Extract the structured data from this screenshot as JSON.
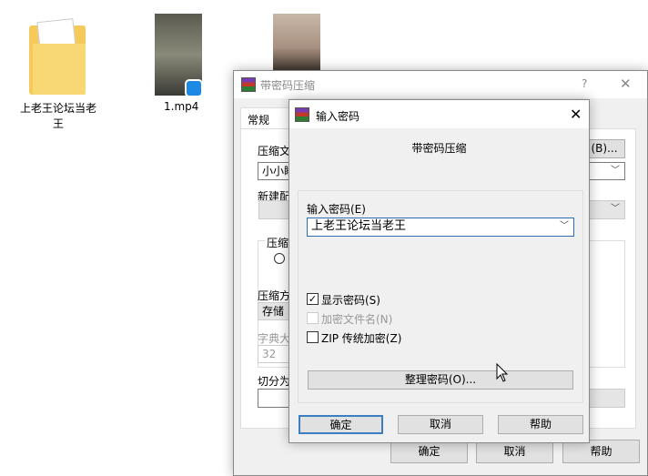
{
  "desktop": {
    "items": [
      {
        "label_line1": "上老王论坛当老",
        "label_line2": "王"
      },
      {
        "label": "1.mp4"
      },
      {
        "label": ""
      }
    ]
  },
  "back_dialog": {
    "title": "带密码压缩",
    "help": "?",
    "close": "✕",
    "tab": "常规",
    "archive_name_label": "压缩文",
    "archive_name_value": "小小睡",
    "browse": "(B)...",
    "profile_label": "新建配",
    "format_group": "压缩",
    "method_label": "压缩方",
    "method_value": "存储",
    "dict_label": "字典大",
    "dict_value": "32",
    "split_label": "切分为",
    "ok": "确定",
    "cancel": "取消",
    "help_btn": "帮助"
  },
  "front_dialog": {
    "title": "输入密码",
    "close": "✕",
    "subtitle": "带密码压缩",
    "password_label": "输入密码(E)",
    "password_value": "上老王论坛当老王",
    "show_password": "显示密码(S)",
    "show_password_checked": true,
    "encrypt_names": "加密文件名(N)",
    "encrypt_names_checked": false,
    "zip_legacy": "ZIP 传统加密(Z)",
    "zip_legacy_checked": false,
    "organize": "整理密码(O)...",
    "ok": "确定",
    "cancel": "取消",
    "help": "帮助"
  }
}
